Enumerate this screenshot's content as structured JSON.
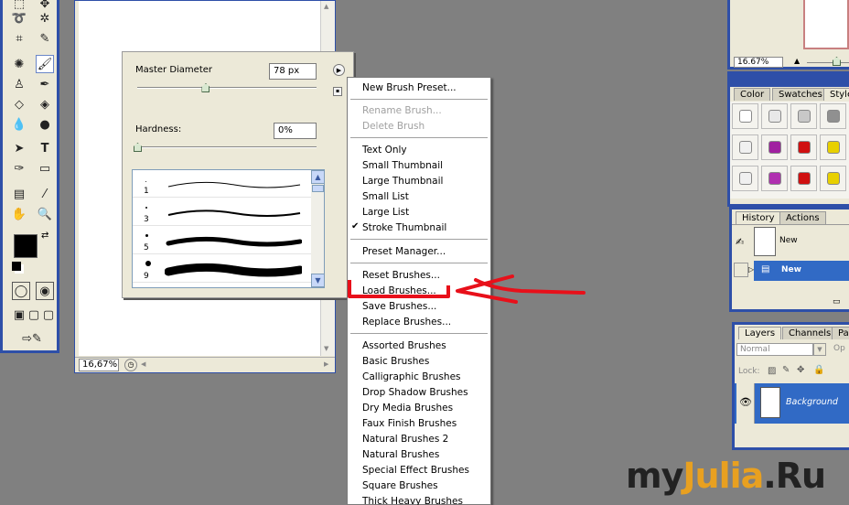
{
  "document": {
    "zoom": "16,67%"
  },
  "brush_panel": {
    "master_diameter_label": "Master Diameter",
    "master_diameter_value": "78 px",
    "master_diameter_slider": 0.38,
    "hardness_label": "Hardness:",
    "hardness_value": "0%",
    "hardness_slider": 0.0,
    "brushes": [
      {
        "size": "1"
      },
      {
        "size": "3"
      },
      {
        "size": "5"
      },
      {
        "size": "9"
      }
    ]
  },
  "menu": {
    "items": [
      {
        "label": "New Brush Preset...",
        "disabled": false
      },
      {
        "label": "Rename Brush...",
        "disabled": true
      },
      {
        "label": "Delete Brush",
        "disabled": true
      },
      {
        "label": "Text Only",
        "disabled": false
      },
      {
        "label": "Small Thumbnail",
        "disabled": false
      },
      {
        "label": "Large Thumbnail",
        "disabled": false
      },
      {
        "label": "Small List",
        "disabled": false
      },
      {
        "label": "Large List",
        "disabled": false
      },
      {
        "label": "Stroke Thumbnail",
        "disabled": false,
        "checked": true
      },
      {
        "label": "Preset Manager...",
        "disabled": false
      },
      {
        "label": "Reset Brushes...",
        "disabled": false
      },
      {
        "label": "Load Brushes...",
        "disabled": false,
        "highlighted": true
      },
      {
        "label": "Save Brushes...",
        "disabled": false
      },
      {
        "label": "Replace Brushes...",
        "disabled": false
      },
      {
        "label": "Assorted Brushes",
        "disabled": false
      },
      {
        "label": "Basic Brushes",
        "disabled": false
      },
      {
        "label": "Calligraphic Brushes",
        "disabled": false
      },
      {
        "label": "Drop Shadow Brushes",
        "disabled": false
      },
      {
        "label": "Dry Media Brushes",
        "disabled": false
      },
      {
        "label": "Faux Finish Brushes",
        "disabled": false
      },
      {
        "label": "Natural Brushes 2",
        "disabled": false
      },
      {
        "label": "Natural Brushes",
        "disabled": false
      },
      {
        "label": "Special Effect Brushes",
        "disabled": false
      },
      {
        "label": "Square Brushes",
        "disabled": false
      },
      {
        "label": "Thick Heavy Brushes",
        "disabled": false
      }
    ],
    "checkmark": "✔"
  },
  "navigator": {
    "zoom": "16.67%"
  },
  "styles_panel": {
    "tabs": [
      "Color",
      "Swatches",
      "Style"
    ],
    "swatch_colors": [
      "#ffffff",
      "#e8e8e8",
      "#c8c8c8",
      "#909090",
      "#f0f0f0",
      "#a020a0",
      "#d01010",
      "#e8d000",
      "#f0f0f0",
      "#b030b0",
      "#d01010",
      "#e8d000"
    ]
  },
  "history_panel": {
    "tabs": [
      "History",
      "Actions"
    ],
    "snapshot_label": "New",
    "state_label": "New"
  },
  "layers_panel": {
    "tabs": [
      "Layers",
      "Channels",
      "Pat"
    ],
    "blend_mode": "Normal",
    "opacity_label": "Op",
    "lock_label": "Lock:",
    "layer_name": "Background"
  },
  "watermark": {
    "part1": "my",
    "part2": "Julia",
    "part3": ".Ru"
  },
  "colors": {
    "accent_blue": "#2e4fa8",
    "selection_blue": "#316ac5",
    "annotation_red": "#e8101a",
    "watermark_dark": "#222222",
    "watermark_orange": "#e8a020"
  }
}
